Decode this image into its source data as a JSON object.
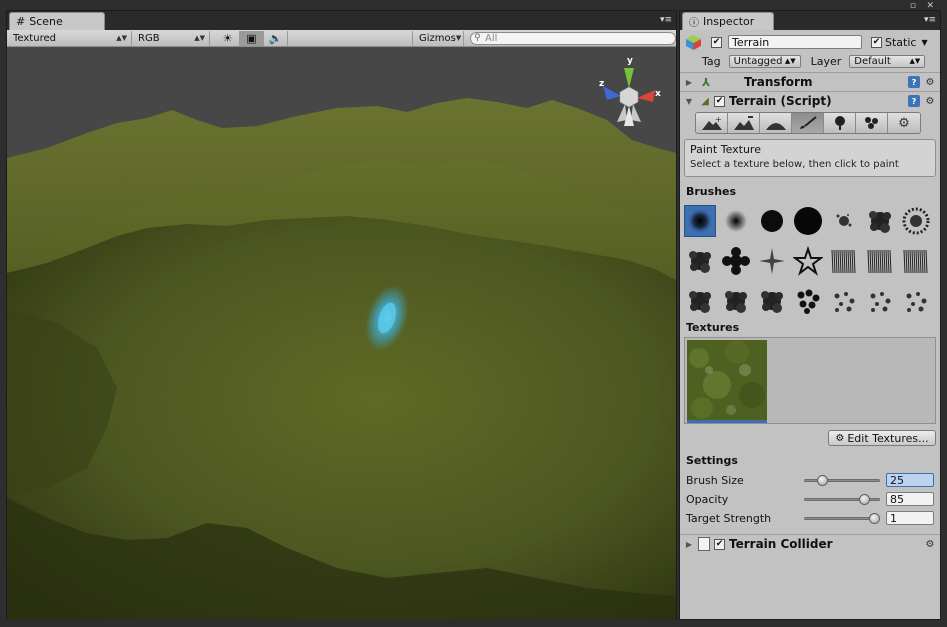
{
  "scene": {
    "tab_label": "Scene",
    "render_mode": "Textured",
    "color_mode": "RGB",
    "gizmos_label": "Gizmos",
    "search_placeholder": "All",
    "axis_labels": {
      "y": "y",
      "x": "x",
      "z": "z"
    }
  },
  "inspector": {
    "tab_label": "Inspector",
    "object_name": "Terrain",
    "static_label": "Static",
    "tag_label": "Tag",
    "tag_value": "Untagged",
    "layer_label": "Layer",
    "layer_value": "Default",
    "transform_label": "Transform",
    "terrain_script_label": "Terrain (Script)",
    "paint_title": "Paint Texture",
    "paint_hint": "Select a texture below, then click to paint",
    "brushes_label": "Brushes",
    "textures_label": "Textures",
    "edit_textures_label": "Edit Textures...",
    "settings_label": "Settings",
    "settings": [
      {
        "label": "Brush Size",
        "value": "25",
        "level": 0.18
      },
      {
        "label": "Opacity",
        "value": "85",
        "level": 0.82
      },
      {
        "label": "Target Strength",
        "value": "1",
        "level": 0.97
      }
    ],
    "collider_label": "Terrain Collider"
  },
  "colors": {
    "terrain": "#5a6423",
    "sky": "#474747",
    "brush_highlight": "#3d6fb3",
    "cursor_glow": "#3fb4d8"
  }
}
